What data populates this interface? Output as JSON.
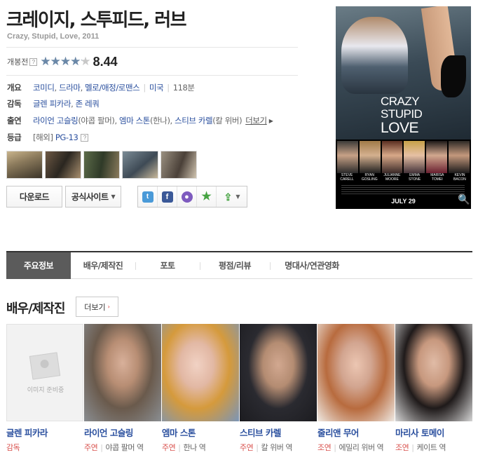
{
  "movie": {
    "title": "크레이지, 스투피드, 러브",
    "original": "Crazy, Stupid, Love, 2011",
    "rating_label": "개봉전",
    "help_glyph": "?",
    "stars_glyph": "★★★★★",
    "rating_fraction": 0.844,
    "rating_value": "8.44"
  },
  "info": {
    "overview": {
      "label": "개요",
      "genres": [
        "코미디",
        "드라마",
        "멜로/애정/로맨스"
      ],
      "country": "미국",
      "runtime": "118분"
    },
    "director": {
      "label": "감독",
      "names": [
        "글렌 피카라",
        "존 레쿼"
      ]
    },
    "cast": {
      "label": "출연",
      "items": [
        {
          "name": "라이언 고슬링",
          "role": "(야콥 팔머)"
        },
        {
          "name": "엠마 스톤",
          "role": "(한나)"
        },
        {
          "name": "스티브 카렐",
          "role": "(칼 위버)"
        }
      ],
      "more": "더보기",
      "arrow": "▶"
    },
    "grade": {
      "label": "등급",
      "prefix": "[해외]",
      "value": "PG-13"
    }
  },
  "buttons": {
    "download": "다운로드",
    "official": "공식사이트",
    "caret": "▼",
    "share_icons": [
      "twitter-icon",
      "facebook-icon",
      "chat-icon",
      "star-icon",
      "share-icon"
    ]
  },
  "share": {
    "twitter": "t",
    "facebook": "f",
    "chat": "●",
    "star": "★",
    "export": "⇪"
  },
  "poster": {
    "line1": "CRAZY",
    "line2": "STUPID",
    "line3": "LOVE",
    "names": [
      "STEVE CARELL",
      "RYAN GOSLING",
      "JULIANNE MOORE",
      "EMMA STONE",
      "MARISA TOMEI",
      "KEVIN BACON"
    ],
    "date": "JULY 29",
    "zoom_glyph": "🔍"
  },
  "tabs": [
    {
      "label": "주요정보",
      "active": true
    },
    {
      "label": "배우/제작진",
      "active": false
    },
    {
      "label": "포토",
      "active": false
    },
    {
      "label": "평점/리뷰",
      "active": false
    },
    {
      "label": "명대사/연관영화",
      "active": false
    }
  ],
  "section": {
    "title": "배우/제작진",
    "more": "더보기",
    "more_arrow": "›"
  },
  "people": [
    {
      "name": "글렌 피카라",
      "role": "감독",
      "character": "",
      "placeholder": "이미지 준비중"
    },
    {
      "name": "라이언 고슬링",
      "role": "주연",
      "character": "야콥 팔머 역"
    },
    {
      "name": "엠마 스톤",
      "role": "주연",
      "character": "한나 역"
    },
    {
      "name": "스티브 카렐",
      "role": "주연",
      "character": "칼 위버 역"
    },
    {
      "name": "줄리앤 무어",
      "role": "조연",
      "character": "에밀리 위버 역"
    },
    {
      "name": "마리사 토메이",
      "role": "조연",
      "character": "케이트 역"
    }
  ],
  "colors": {
    "link": "#2a4f9e",
    "role": "#d9534f",
    "active_tab": "#5b5b5b",
    "star": "#6a88a8"
  }
}
